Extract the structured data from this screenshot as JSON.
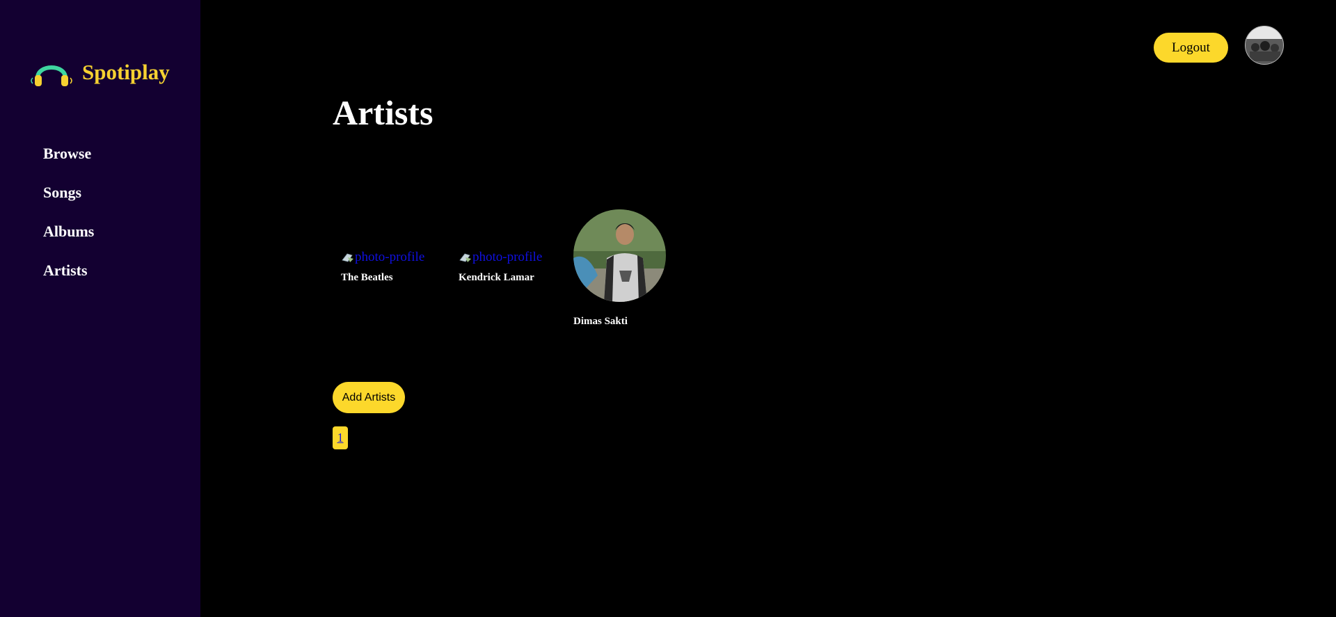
{
  "app": {
    "brand_name": "Spotiplay"
  },
  "sidebar": {
    "items": [
      {
        "label": "Browse"
      },
      {
        "label": "Songs"
      },
      {
        "label": "Albums"
      },
      {
        "label": "Artists"
      }
    ]
  },
  "header": {
    "logout_label": "Logout"
  },
  "main": {
    "title": "Artists",
    "artists": [
      {
        "name": "The Beatles",
        "image_alt": "photo-profile"
      },
      {
        "name": "Kendrick Lamar",
        "image_alt": "photo-profile"
      },
      {
        "name": "Dimas Sakti"
      }
    ],
    "add_button_label": "Add Artists",
    "pagination": {
      "current_page": "1"
    }
  },
  "colors": {
    "sidebar_bg": "#130031",
    "accent": "#fcd82b",
    "page_bg": "#000000",
    "link": "#1010e0"
  },
  "icons": {
    "brand": "headphones-icon",
    "broken_image": "broken-image-icon"
  }
}
